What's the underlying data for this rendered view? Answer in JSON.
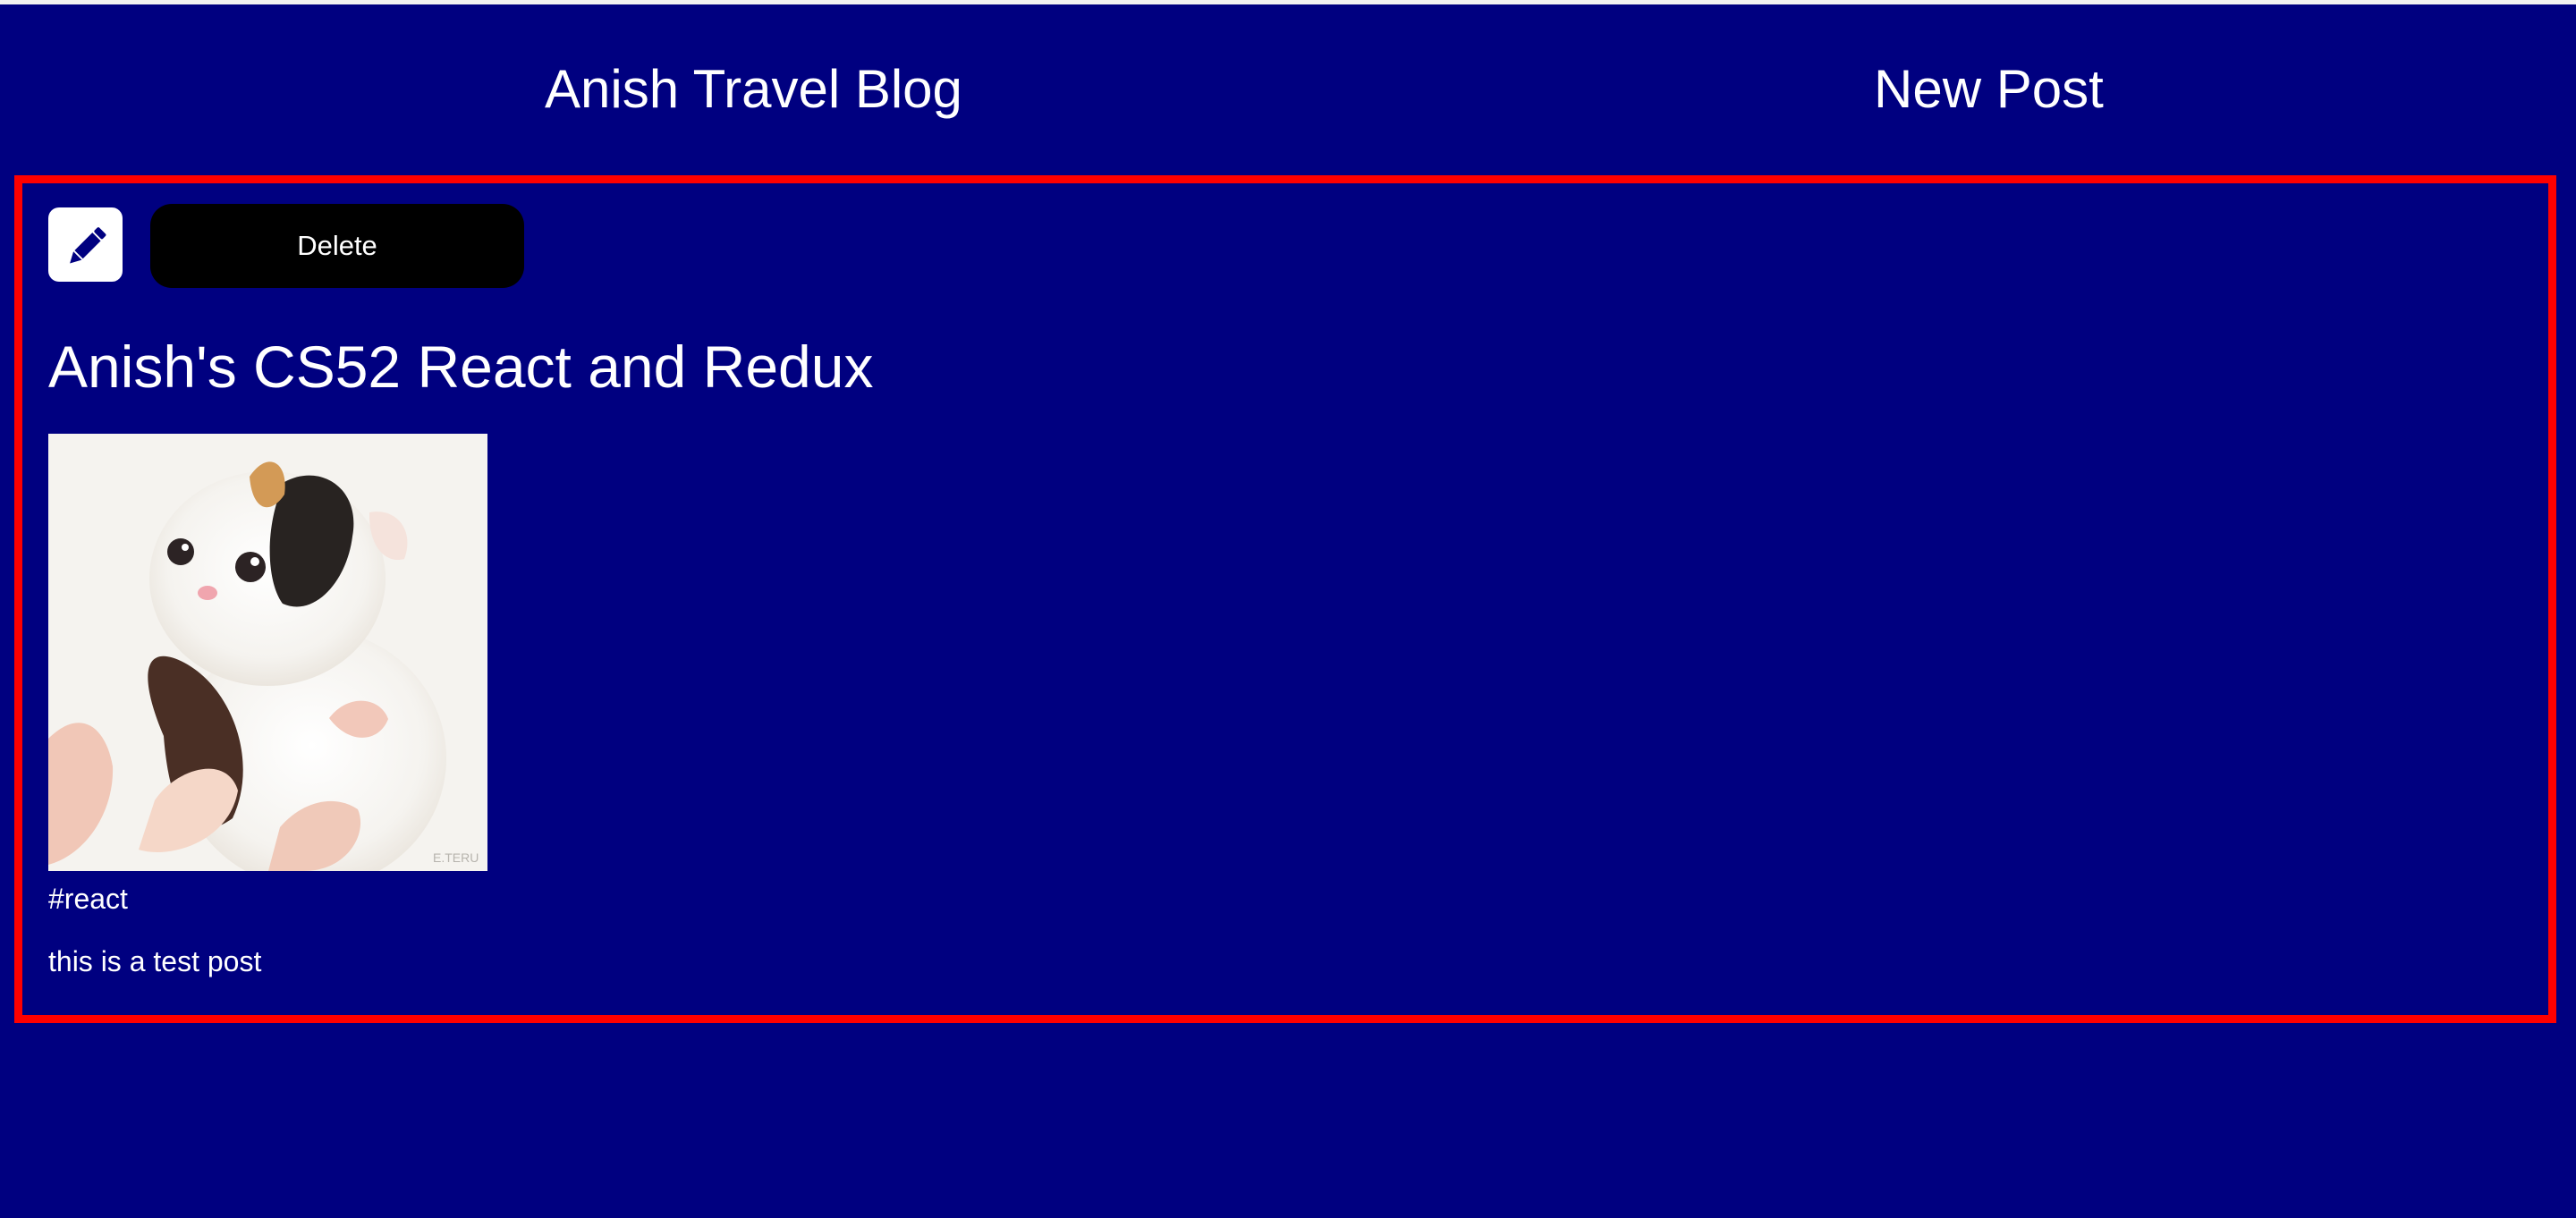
{
  "nav": {
    "home_label": "Anish Travel Blog",
    "new_post_label": "New Post"
  },
  "post": {
    "edit_icon": "pencil-icon",
    "delete_label": "Delete",
    "title": "Anish's CS52 React and Redux",
    "image_alt": "kitten",
    "image_watermark": "E.TERU",
    "tags": "#react",
    "content": "this is a test post"
  },
  "colors": {
    "background": "#000080",
    "card_border": "#ff0000",
    "text": "#ffffff",
    "delete_button": "#000000"
  }
}
